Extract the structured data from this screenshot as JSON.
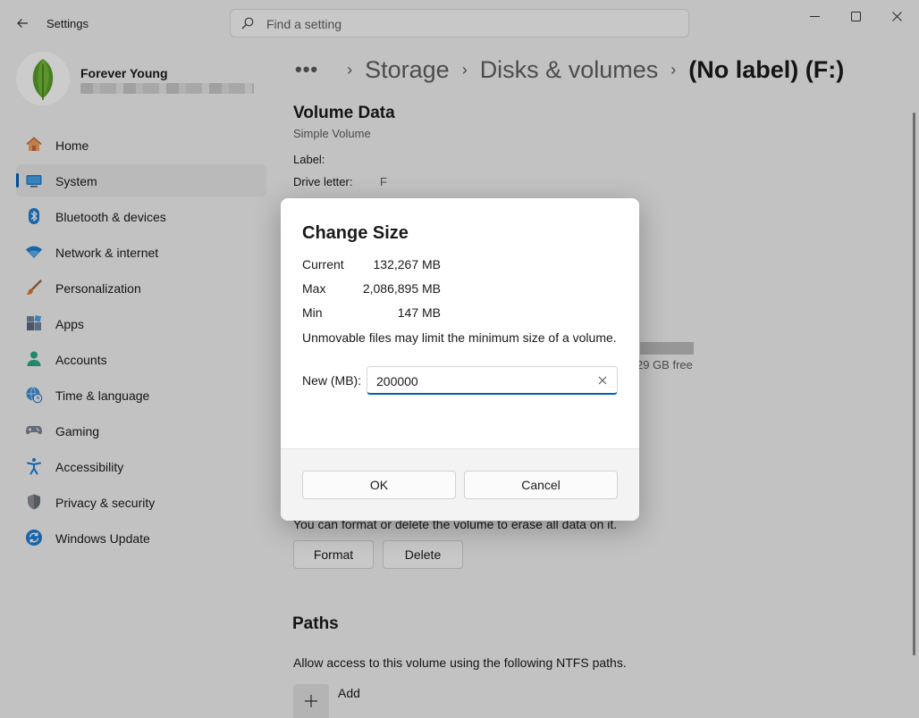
{
  "titlebar": {
    "app_title": "Settings"
  },
  "search": {
    "placeholder": "Find a setting"
  },
  "profile": {
    "name": "Forever Young"
  },
  "nav": {
    "items": [
      {
        "label": "Home",
        "icon": "home-icon"
      },
      {
        "label": "System",
        "icon": "system-icon",
        "selected": true
      },
      {
        "label": "Bluetooth & devices",
        "icon": "bluetooth-icon"
      },
      {
        "label": "Network & internet",
        "icon": "wifi-icon"
      },
      {
        "label": "Personalization",
        "icon": "brush-icon"
      },
      {
        "label": "Apps",
        "icon": "apps-icon"
      },
      {
        "label": "Accounts",
        "icon": "person-icon"
      },
      {
        "label": "Time & language",
        "icon": "globe-clock-icon"
      },
      {
        "label": "Gaming",
        "icon": "gamepad-icon"
      },
      {
        "label": "Accessibility",
        "icon": "accessibility-icon"
      },
      {
        "label": "Privacy & security",
        "icon": "shield-icon"
      },
      {
        "label": "Windows Update",
        "icon": "update-icon"
      }
    ]
  },
  "breadcrumb": {
    "more": "•••",
    "items": [
      "Storage",
      "Disks & volumes"
    ],
    "current": "(No label) (F:)"
  },
  "volume": {
    "title": "Volume Data",
    "type": "Simple Volume",
    "label_label": "Label:",
    "label_value": "",
    "drive_letter_label": "Drive letter:",
    "drive_letter_value": "F",
    "free_text": "29 GB free"
  },
  "format_section": {
    "note": "You can format or delete the volume to erase all data on it.",
    "format_label": "Format",
    "delete_label": "Delete"
  },
  "paths": {
    "title": "Paths",
    "description": "Allow access to this volume using the following NTFS paths.",
    "add_label": "Add"
  },
  "dialog": {
    "title": "Change Size",
    "current_label": "Current",
    "current_value": "132,267 MB",
    "max_label": "Max",
    "max_value": "2,086,895 MB",
    "min_label": "Min",
    "min_value": "147 MB",
    "note": "Unmovable files may limit the minimum size of a volume.",
    "new_label": "New (MB):",
    "new_value": "200000",
    "ok_label": "OK",
    "cancel_label": "Cancel"
  },
  "colors": {
    "accent": "#005fb8",
    "window_bg": "#f3f3f3"
  }
}
